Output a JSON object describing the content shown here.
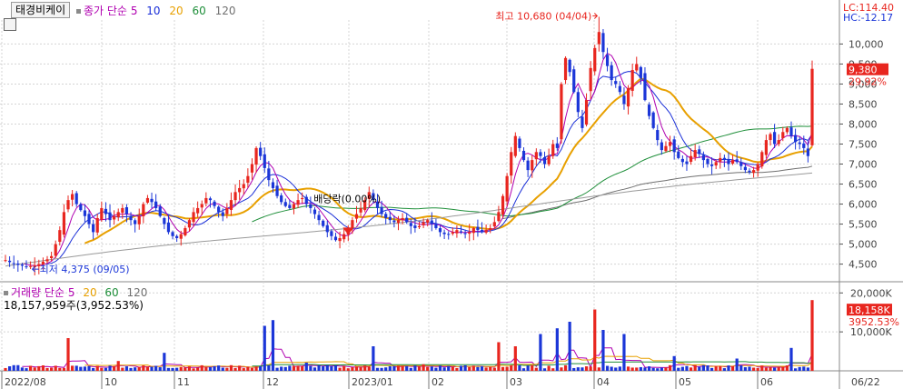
{
  "stock_name": "태경비케이",
  "price_legend": {
    "label": "종가 단순",
    "periods": [
      "5",
      "10",
      "20",
      "60",
      "120"
    ],
    "colors": [
      "#b000b0",
      "#1a2fd8",
      "#e8a000",
      "#1f8f3a",
      "#707070"
    ]
  },
  "lc_label": "LC:114.40",
  "hc_label": "HC:-12.17",
  "high_note": "최고 10,680 (04/04)",
  "low_note": "최저 4,375 (09/05)",
  "dividend_note": "배당락(0.00%)",
  "current_price": "9,380",
  "current_pct": "29.92%",
  "price_axis": [
    "10,000",
    "9,500",
    "9,000",
    "8,500",
    "8,000",
    "7,500",
    "7,000",
    "6,500",
    "6,000",
    "5,500",
    "5,000",
    "4,500"
  ],
  "volume_legend": {
    "label": "거래량 단순",
    "periods": [
      "5",
      "20",
      "60",
      "120"
    ],
    "colors": [
      "#b000b0",
      "#e8a000",
      "#1f8f3a",
      "#707070"
    ]
  },
  "volume_info": "18,157,959주(3,952.53%)",
  "volume_axis": [
    "20,000K",
    "10,000K"
  ],
  "current_volume": "18,158K",
  "current_volume_pct": "3952.53%",
  "date_axis": [
    "2022/08",
    "10",
    "11",
    "12",
    "2023/01",
    "02",
    "03",
    "04",
    "05",
    "06",
    "06/22"
  ],
  "colors": {
    "up": "#e8261f",
    "down": "#1b36d8",
    "grid": "#d4d4d4",
    "highlight": "#e8261f"
  },
  "chart_data": {
    "type": "candlestick",
    "closes": [
      4600,
      4550,
      4520,
      4480,
      4460,
      4440,
      4450,
      4470,
      4500,
      4560,
      4620,
      4700,
      5000,
      5350,
      5800,
      6100,
      6250,
      6000,
      5850,
      5700,
      5500,
      5300,
      5650,
      5900,
      5750,
      5600,
      5700,
      5800,
      5900,
      5750,
      5600,
      5500,
      5700,
      6000,
      6150,
      6050,
      5900,
      5700,
      5500,
      5300,
      5200,
      5150,
      5250,
      5400,
      5600,
      5800,
      5900,
      6000,
      6150,
      6100,
      5950,
      5800,
      5700,
      5900,
      6100,
      6300,
      6400,
      6500,
      6700,
      7000,
      7400,
      7200,
      6900,
      6600,
      6400,
      6200,
      6050,
      5950,
      5900,
      6000,
      6100,
      6150,
      6000,
      5900,
      5750,
      5600,
      5450,
      5300,
      5200,
      5100,
      5150,
      5250,
      5400,
      5600,
      5750,
      5900,
      6100,
      6300,
      6100,
      5900,
      5750,
      5650,
      5600,
      5550,
      5600,
      5650,
      5550,
      5450,
      5400,
      5450,
      5550,
      5600,
      5500,
      5400,
      5300,
      5250,
      5250,
      5300,
      5350,
      5300,
      5250,
      5300,
      5400,
      5350,
      5300,
      5350,
      5400,
      5550,
      5800,
      6200,
      6700,
      7300,
      7700,
      7400,
      7100,
      6850,
      7100,
      7300,
      7200,
      7000,
      7200,
      7500,
      7400,
      9000,
      9650,
      9300,
      8800,
      8300,
      7900,
      8600,
      9400,
      9900,
      10300,
      9800,
      9450,
      9100,
      9000,
      8800,
      8500,
      8900,
      9350,
      9500,
      9150,
      8600,
      8200,
      7900,
      7600,
      7350,
      7450,
      7550,
      7300,
      7150,
      7050,
      7000,
      7200,
      7350,
      7250,
      7100,
      7000,
      6950,
      7050,
      7150,
      7100,
      7000,
      7100,
      7050,
      6950,
      6850,
      6800,
      6850,
      7000,
      7300,
      7600,
      7750,
      7500,
      7600,
      7800,
      7900,
      7700,
      7550,
      7500,
      7400,
      7200,
      9380
    ],
    "high_label": "10,680",
    "low_label": "4,375",
    "ylim": [
      4150,
      10600
    ],
    "volume_unit": "K",
    "volume_ylim": [
      0,
      21000
    ],
    "current_volume": 18158
  }
}
